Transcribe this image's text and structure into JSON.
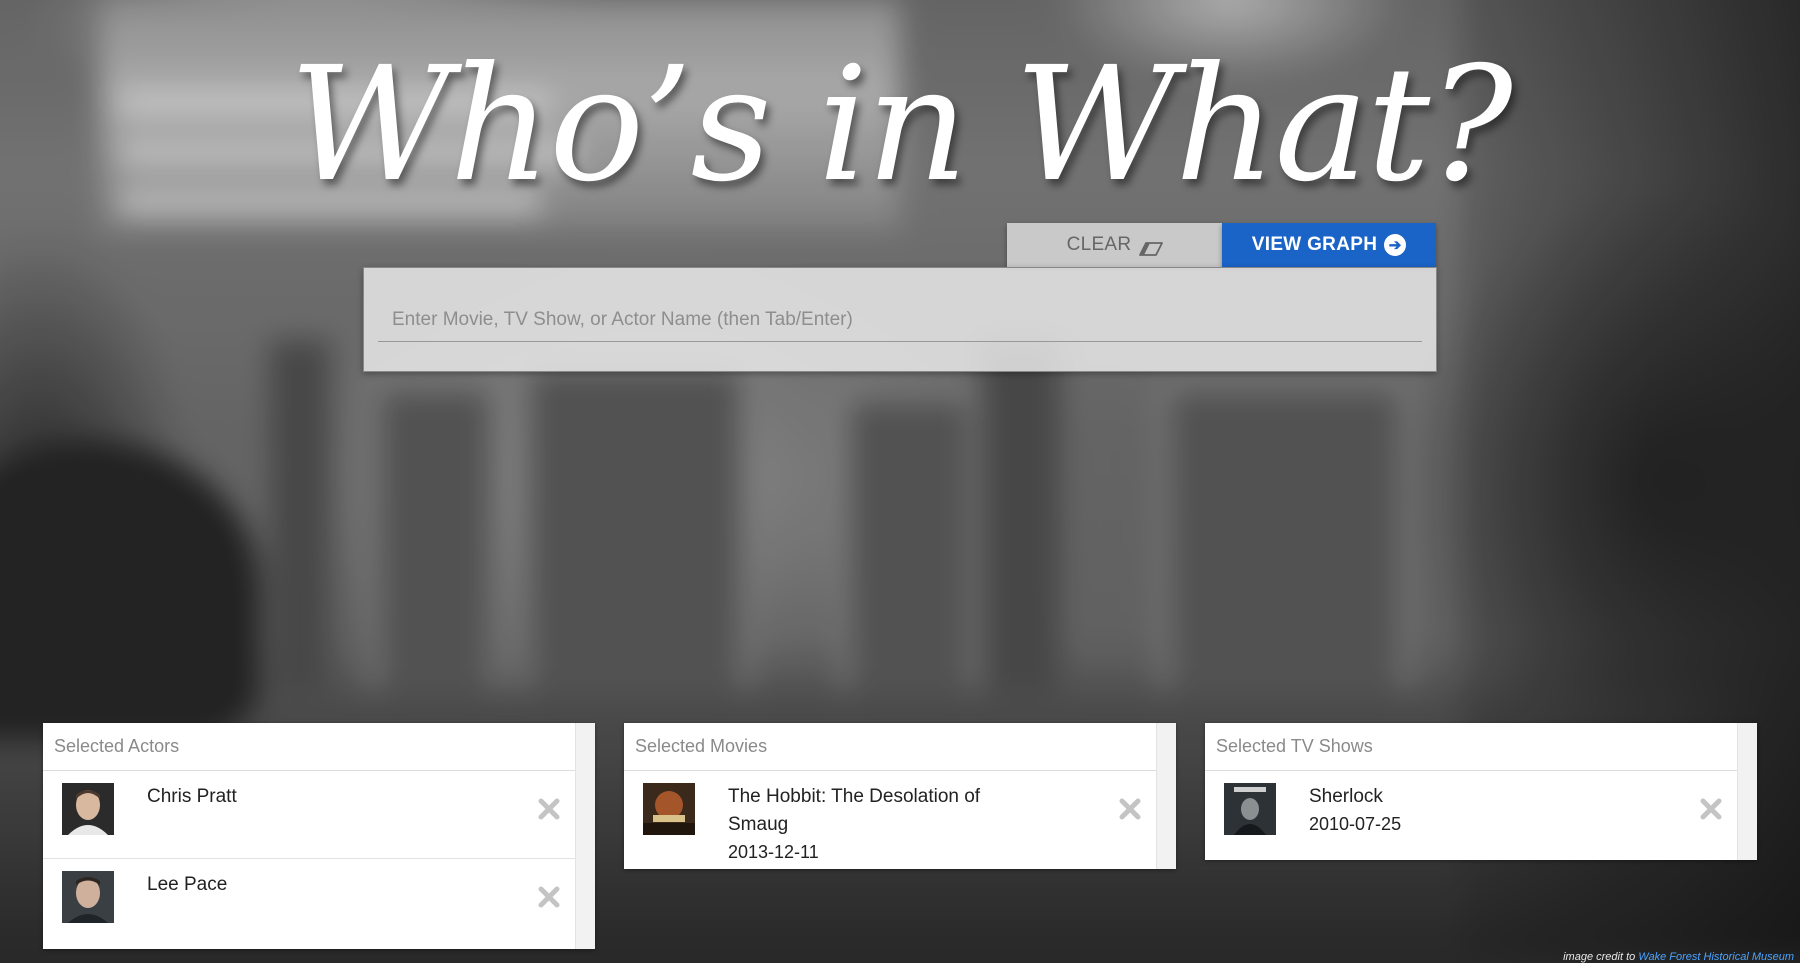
{
  "title": "Who’s in What?",
  "toolbar": {
    "clear_label": "CLEAR",
    "view_graph_label": "VIEW GRAPH",
    "clear_icon": "eraser-icon",
    "view_graph_icon": "arrow-circle-right-icon",
    "accent_color": "#1a63c7"
  },
  "search": {
    "placeholder": "Enter Movie, TV Show, or Actor Name (then Tab/Enter)",
    "value": ""
  },
  "actors": {
    "header": "Selected Actors",
    "items": [
      {
        "name": "Chris Pratt"
      },
      {
        "name": "Lee Pace"
      }
    ]
  },
  "movies": {
    "header": "Selected Movies",
    "items": [
      {
        "title": "The Hobbit: The Desolation of Smaug",
        "date": "2013-12-11"
      }
    ]
  },
  "shows": {
    "header": "Selected TV Shows",
    "items": [
      {
        "title": "Sherlock",
        "date": "2010-07-25"
      }
    ]
  },
  "credit": {
    "prefix": "image credit to",
    "link_text": "Wake Forest Historical Museum"
  }
}
